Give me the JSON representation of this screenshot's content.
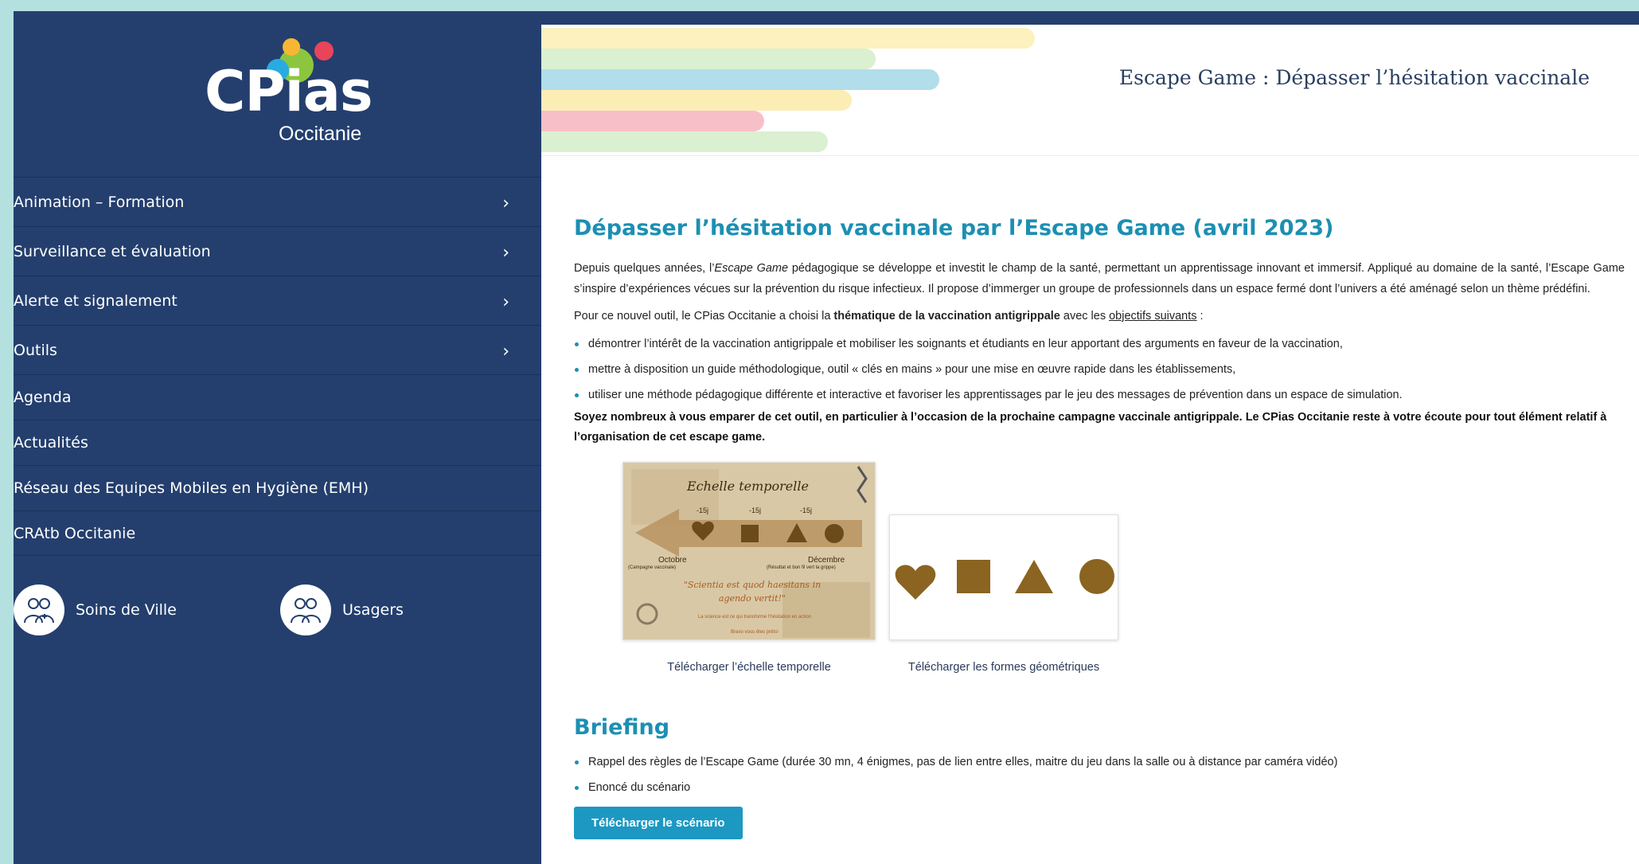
{
  "colors": {
    "sidebar": "#243f6e",
    "accent": "#1c8fb3",
    "button": "#1c98c2",
    "frame": "#b4e1df"
  },
  "logo": {
    "wordmark": "CPias",
    "subtitle": "Occitanie"
  },
  "nav": [
    {
      "label": "Animation – Formation",
      "has_submenu": true,
      "icon": "chevron-right-icon"
    },
    {
      "label": "Surveillance et évaluation",
      "has_submenu": true,
      "icon": "chevron-right-icon"
    },
    {
      "label": "Alerte et signalement",
      "has_submenu": true,
      "icon": "chevron-right-icon"
    },
    {
      "label": "Outils",
      "has_submenu": true,
      "icon": "chevron-right-icon"
    },
    {
      "label": "Agenda",
      "has_submenu": false
    },
    {
      "label": "Actualités",
      "has_submenu": false
    },
    {
      "label": "Réseau des Equipes Mobiles en Hygiène (EMH)",
      "has_submenu": false
    },
    {
      "label": "CRAtb Occitanie",
      "has_submenu": false
    }
  ],
  "chevron": "›",
  "audience": [
    {
      "label": "Soins de Ville",
      "icon": "healthcare-team-icon"
    },
    {
      "label": "Usagers",
      "icon": "users-icon"
    }
  ],
  "banner": {
    "title": "Escape Game : Dépasser l’hésitation vaccinale"
  },
  "article": {
    "heading": "Dépasser l’hésitation vaccinale par l’Escape Game (avril 2023)",
    "intro_before_em": "Depuis quelques années, l’",
    "intro_em": "Escape Game",
    "intro_after_em": " pédagogique se développe et investit le champ de la santé, permettant un apprentissage innovant et immersif. Appliqué au domaine de la santé, l’Escape Game s’inspire d’expériences vécues sur la prévention du risque infectieux. Il propose d’immerger un groupe de professionnels dans un espace fermé dont l’univers a été aménagé selon un thème prédéfini.",
    "p2_a": "Pour ce nouvel outil, le CPias Occitanie a choisi la ",
    "p2_bold": "thématique de la vaccination antigrippale",
    "p2_b": " avec les ",
    "p2_link": "objectifs suivants",
    "p2_c": " :",
    "objectives": [
      "démontrer l’intérêt de la vaccination antigrippale et mobiliser les soignants et étudiants en leur apportant des arguments en faveur de la vaccination,",
      "mettre à disposition un guide méthodologique, outil « clés en mains » pour une mise en œuvre rapide dans les établissements,",
      "utiliser une méthode pédagogique différente et interactive et favoriser les apprentissages par le jeu des messages de prévention dans un espace de simulation."
    ],
    "callout": "Soyez nombreux à vous emparer de cet outil, en particulier à l’occasion de la prochaine campagne vaccinale antigrippale. Le CPias Occitanie reste à votre écoute pour tout élément relatif à l’organisation de cet escape game.",
    "timeline_img": {
      "title": "Echelle temporelle",
      "marks": [
        "-15j",
        "-15j",
        "-15j"
      ],
      "left_label": "Octobre",
      "left_sub": "(Campagne vaccinale)",
      "right_label": "Décembre",
      "right_sub": "(Résultat et bon fil vert la grippe)",
      "quote": "\"Scientia est quod haesitans in agendo vertit!\"",
      "note_1": "La science est ce qui transforme l'hésitation en action",
      "note_2": "Bravo vous êtes prêts!"
    },
    "figures": [
      {
        "caption": "Télécharger l’échelle temporelle"
      },
      {
        "caption": "Télécharger les formes géométriques"
      }
    ],
    "briefing_title": "Briefing",
    "briefing_items": [
      "Rappel des règles de l’Escape Game (durée 30 mn, 4 énigmes, pas de lien entre elles, maitre du jeu dans la salle ou à distance par caméra vidéo)",
      "Enoncé du scénario"
    ],
    "download_button": "Télécharger le scénario"
  }
}
